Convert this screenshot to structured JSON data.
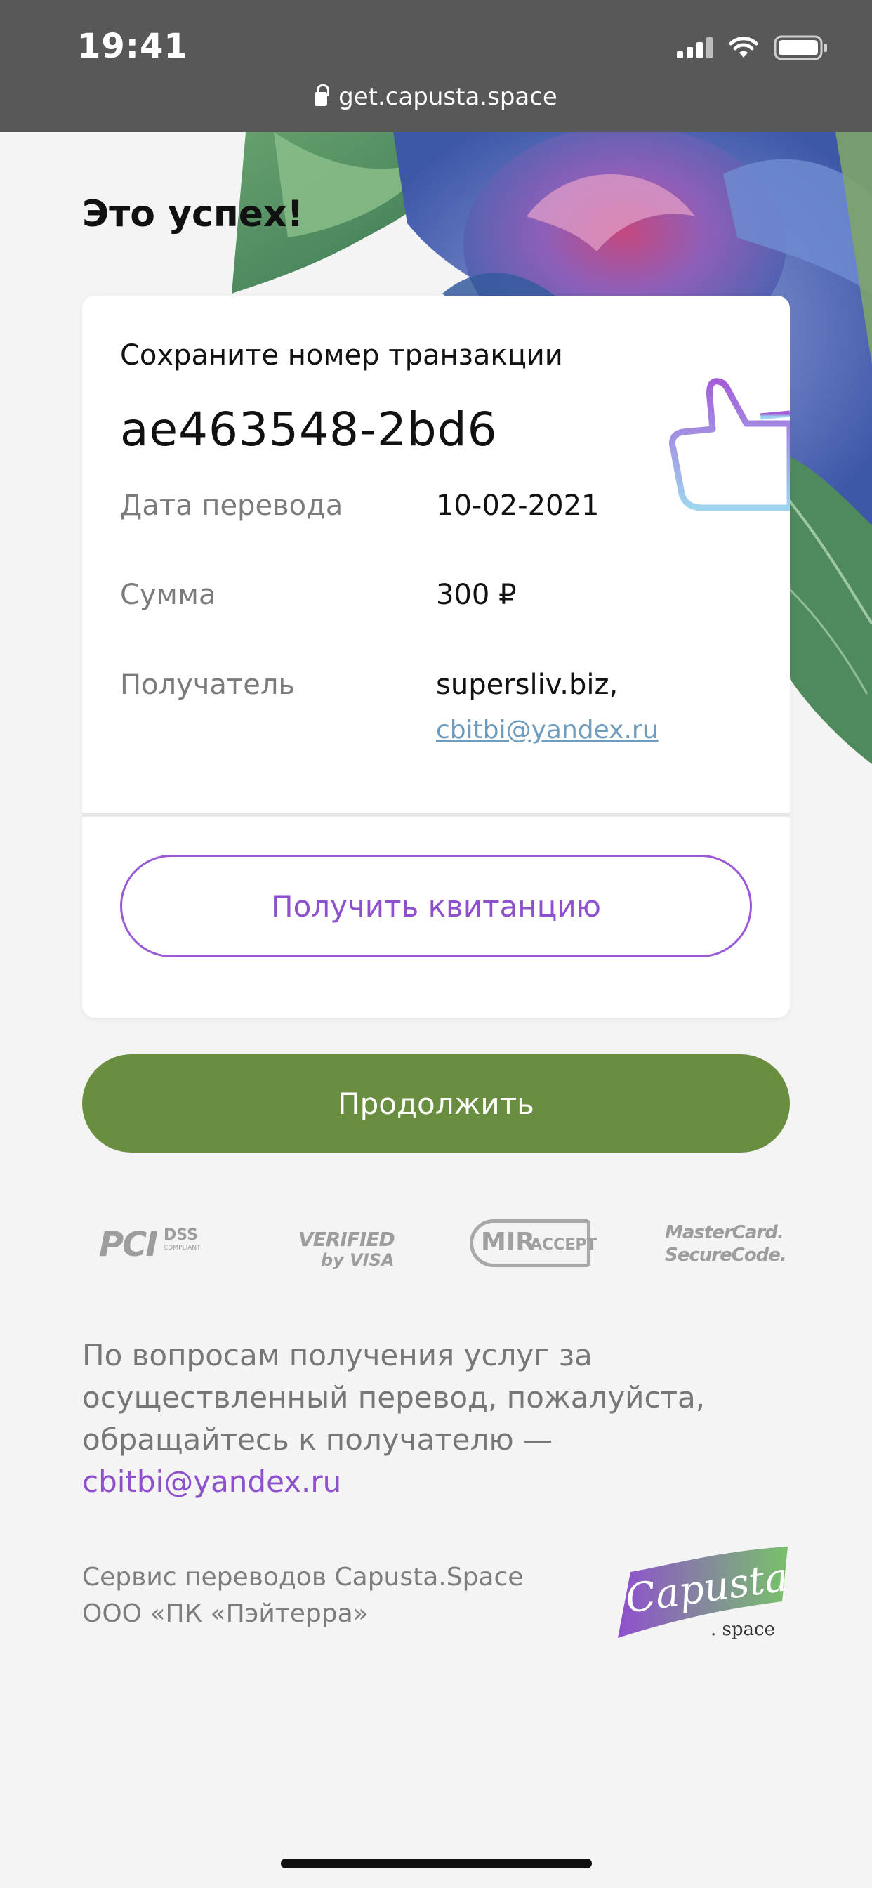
{
  "status_bar": {
    "time": "19:41",
    "url": "get.capusta.space",
    "icons": [
      "signal-icon",
      "wifi-icon",
      "battery-icon"
    ]
  },
  "page": {
    "heading": "Это успех!"
  },
  "card": {
    "save_label": "Сохраните номер транзакции",
    "transaction_id": "ae463548-2bd6",
    "rows": [
      {
        "label": "Дата перевода",
        "value": "10-02-2021"
      },
      {
        "label": "Сумма",
        "value": "300 ₽"
      },
      {
        "label": "Получатель",
        "value": "supersliv.biz,"
      }
    ],
    "recipient_email": "cbitbi@yandex.ru",
    "receipt_button": "Получить квитанцию"
  },
  "continue_button": "Продолжить",
  "payment_logos": {
    "pci": "PCI",
    "pci_dss": "DSS",
    "pci_small": "COMPLIANT",
    "visa_top": "VERIFIED",
    "visa_bottom": "by VISA",
    "mir": "MIR",
    "mir_accept": "ACCEPT",
    "mc_top": "MasterCard.",
    "mc_bottom": "SecureCode."
  },
  "help": {
    "text": "По вопросам получения услуг за осуществленный перевод, пожалуйста, обращайтесь к получателю —",
    "email": "cbitbi@yandex.ru"
  },
  "footer": {
    "line1": "Сервис переводов Capusta.Space",
    "line2": "ООО «ПК «Пэйтерра»",
    "logo_text": "Capusta",
    "logo_sub": ". space"
  },
  "colors": {
    "accent_purple": "#8e50cc",
    "accent_green": "#6a8e3f",
    "status_bar": "#585858"
  }
}
